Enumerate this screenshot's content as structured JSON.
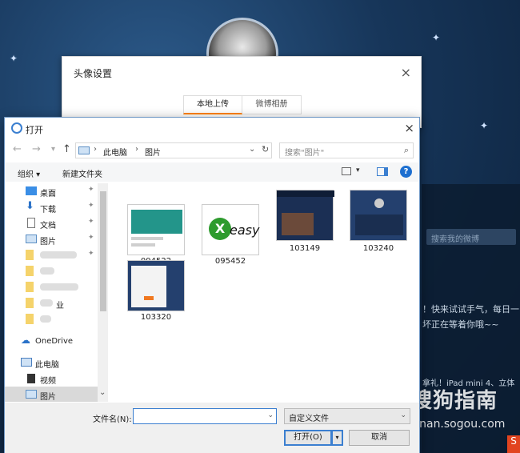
{
  "setting_dialog": {
    "title": "头像设置",
    "close": "×",
    "tabs": [
      "本地上传",
      "微博相册"
    ]
  },
  "background": {
    "search_placeholder": "搜索我的微博",
    "text_line1": "！快来试试手气，每日一",
    "text_line2": "坏正在等着你哦~~",
    "text_line3": "拿礼！iPad mini 4、立体"
  },
  "watermark": {
    "title": "搜狗指南",
    "url": "zhinan.sogou.com"
  },
  "open_dialog": {
    "title": "打开",
    "close": "×",
    "nav": {
      "back": "←",
      "forward": "→",
      "recent": "▾",
      "up": "↑"
    },
    "address": {
      "segments": [
        "此电脑",
        "图片"
      ],
      "separator": "›",
      "chevron": "⌄",
      "refresh": "↻"
    },
    "search": {
      "placeholder": "搜索\"图片\"",
      "icon": "⌕"
    },
    "toolbar": {
      "organize": "组织 ▾",
      "new_folder": "新建文件夹",
      "view_caret": "▾",
      "help": "?"
    },
    "sidebar": {
      "items": [
        {
          "label": "桌面",
          "icon": "desktop-icon",
          "pinned": true
        },
        {
          "label": "下载",
          "icon": "download-icon",
          "pinned": true
        },
        {
          "label": "文档",
          "icon": "document-icon",
          "pinned": true
        },
        {
          "label": "图片",
          "icon": "pictures-icon",
          "pinned": true
        },
        {
          "label": "",
          "icon": "folder-icon",
          "pinned": true
        },
        {
          "label": "",
          "icon": "folder-icon",
          "pinned": false
        },
        {
          "label": "",
          "icon": "folder-icon",
          "pinned": false
        },
        {
          "label": "业",
          "icon": "folder-icon",
          "pinned": false
        },
        {
          "label": "",
          "icon": "folder-icon",
          "pinned": false
        },
        {
          "label": "OneDrive",
          "icon": "cloud-icon",
          "pinned": false
        },
        {
          "label": "此电脑",
          "icon": "pc-icon",
          "pinned": false
        },
        {
          "label": "视频",
          "icon": "video-icon",
          "pinned": false
        },
        {
          "label": "图片",
          "icon": "pictures-icon",
          "pinned": false
        }
      ],
      "pin_glyph": "✦",
      "scroll_down": "⌄"
    },
    "files": [
      {
        "name": "094522",
        "thumb_color": "#23958a"
      },
      {
        "name": "095452",
        "thumb_color": "#2e9b2e"
      },
      {
        "name": "103149",
        "thumb_color": "#1b2f54"
      },
      {
        "name": "103240",
        "thumb_color": "#24406e"
      },
      {
        "name": "103320",
        "thumb_color": "#f3f3f3"
      }
    ],
    "thumb_text": {
      "easy": "easy",
      "excel": "X"
    },
    "footer": {
      "filename_label": "文件名(N):",
      "filename_value": "",
      "filetype": "自定义文件",
      "open_label": "打开(O)",
      "open_split": "▾",
      "cancel_label": "取消",
      "caret": "⌄"
    }
  },
  "corner_badge": "S"
}
